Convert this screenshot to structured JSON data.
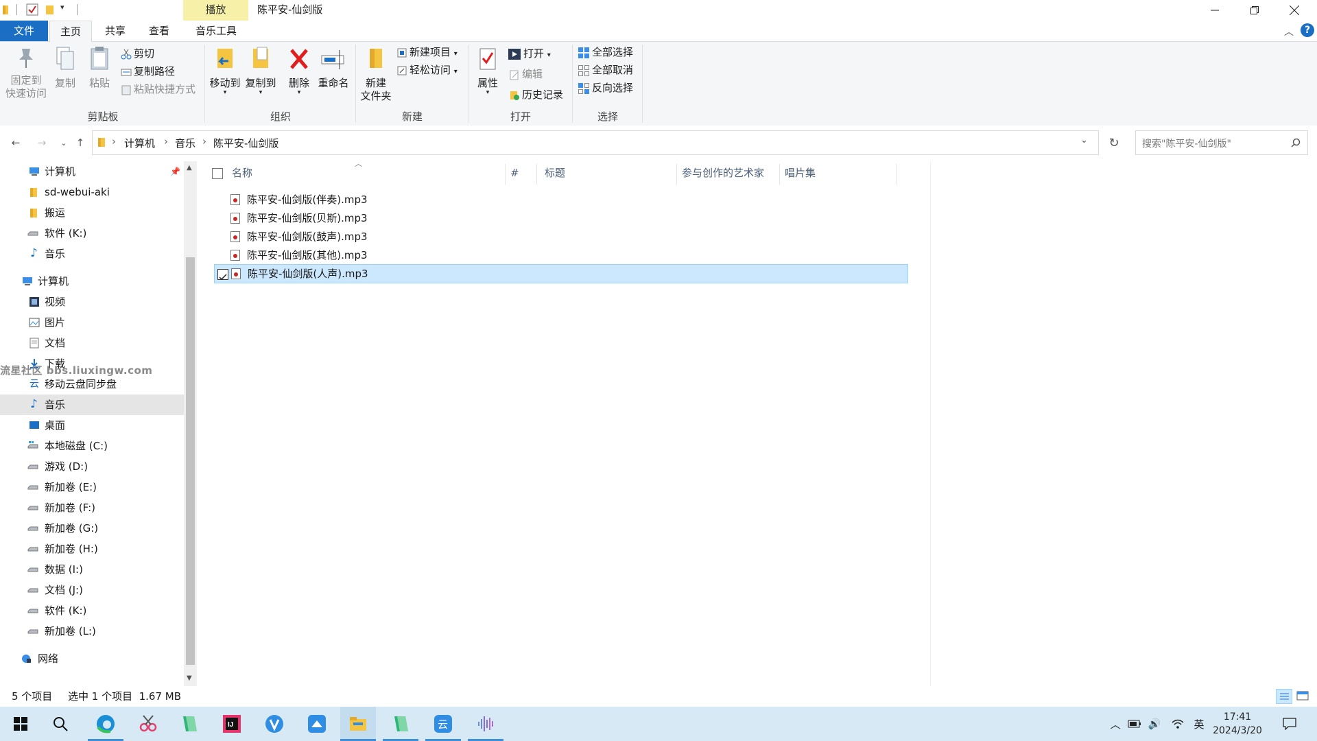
{
  "window": {
    "title": "陈平安-仙剑版",
    "contextual_tab": "播放"
  },
  "tabs": [
    {
      "label": "文件"
    },
    {
      "label": "主页"
    },
    {
      "label": "共享"
    },
    {
      "label": "查看"
    },
    {
      "label": "音乐工具"
    }
  ],
  "ribbon": {
    "clipboard": {
      "label": "剪贴板",
      "pin": "固定到",
      "pin2": "快速访问",
      "copy": "复制",
      "paste": "粘贴",
      "cut": "剪切",
      "copy_path": "复制路径",
      "paste_shortcut": "粘贴快捷方式"
    },
    "organize": {
      "label": "组织",
      "move_to": "移动到",
      "copy_to": "复制到",
      "delete": "删除",
      "rename": "重命名"
    },
    "new": {
      "label": "新建",
      "new_folder": "新建",
      "new_folder2": "文件夹",
      "new_item": "新建项目",
      "easy_access": "轻松访问"
    },
    "open": {
      "label": "打开",
      "properties": "属性",
      "open": "打开",
      "edit": "编辑",
      "history": "历史记录"
    },
    "select": {
      "label": "选择",
      "select_all": "全部选择",
      "select_none": "全部取消",
      "invert": "反向选择"
    }
  },
  "address": {
    "crumbs": [
      "计算机",
      "音乐",
      "陈平安-仙剑版"
    ],
    "search_placeholder": "搜索\"陈平安-仙剑版\""
  },
  "nav": {
    "quick": [
      {
        "label": "计算机",
        "icon": "computer-icon"
      },
      {
        "label": "sd-webui-aki",
        "icon": "folder-icon"
      },
      {
        "label": "搬运",
        "icon": "folder-icon"
      },
      {
        "label": "软件 (K:)",
        "icon": "drive-icon"
      },
      {
        "label": "音乐",
        "icon": "music-icon"
      }
    ],
    "computer": {
      "label": "计算机"
    },
    "computer_items": [
      {
        "label": "视频",
        "icon": "video-icon"
      },
      {
        "label": "图片",
        "icon": "picture-icon"
      },
      {
        "label": "文档",
        "icon": "document-icon"
      },
      {
        "label": "下载",
        "icon": "download-icon"
      },
      {
        "label": "移动云盘同步盘",
        "icon": "cloud-icon"
      },
      {
        "label": "音乐",
        "icon": "music-icon"
      },
      {
        "label": "桌面",
        "icon": "desktop-icon"
      },
      {
        "label": "本地磁盘 (C:)",
        "icon": "windows-drive-icon"
      },
      {
        "label": "游戏 (D:)",
        "icon": "drive-icon"
      },
      {
        "label": "新加卷 (E:)",
        "icon": "drive-icon"
      },
      {
        "label": "新加卷 (F:)",
        "icon": "drive-icon"
      },
      {
        "label": "新加卷 (G:)",
        "icon": "drive-icon"
      },
      {
        "label": "新加卷 (H:)",
        "icon": "drive-icon"
      },
      {
        "label": "数据 (I:)",
        "icon": "drive-icon"
      },
      {
        "label": "文档 (J:)",
        "icon": "drive-icon"
      },
      {
        "label": "软件 (K:)",
        "icon": "drive-icon"
      },
      {
        "label": "新加卷 (L:)",
        "icon": "drive-icon"
      }
    ],
    "network": {
      "label": "网络"
    }
  },
  "columns": {
    "name": "名称",
    "number": "#",
    "title": "标题",
    "artists": "参与创作的艺术家",
    "album": "唱片集"
  },
  "files": [
    {
      "name": "陈平安-仙剑版(伴奏).mp3"
    },
    {
      "name": "陈平安-仙剑版(贝斯).mp3"
    },
    {
      "name": "陈平安-仙剑版(鼓声).mp3"
    },
    {
      "name": "陈平安-仙剑版(其他).mp3"
    },
    {
      "name": "陈平安-仙剑版(人声).mp3"
    }
  ],
  "status": {
    "count": "5 个项目",
    "selected": "选中 1 个项目  1.67 MB"
  },
  "taskbar": {
    "ime": "英",
    "time": "17:41",
    "date": "2024/3/20"
  },
  "watermark": "流星社区 bbs.liuxingw.com",
  "colors": {
    "accent": "#1a6fc4",
    "selection": "#cce8ff",
    "contextual": "#f6f0a8",
    "taskbar": "#d7e9f4"
  }
}
